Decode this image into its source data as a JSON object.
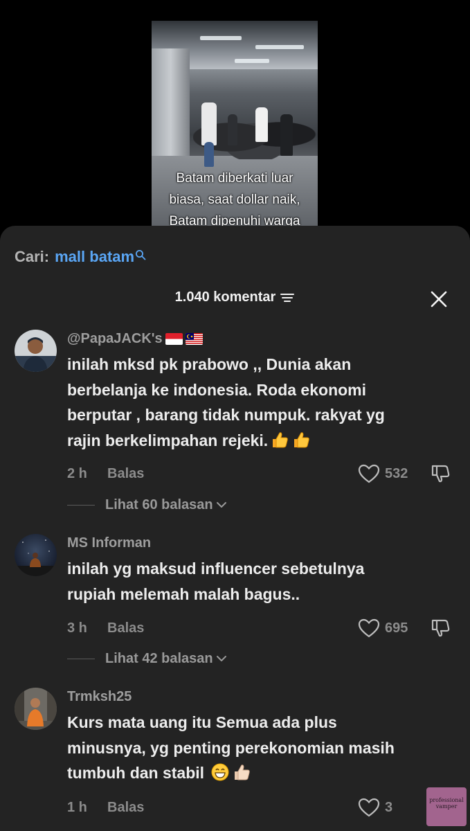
{
  "video": {
    "caption": "Batam diberkati luar\nbiasa, saat dollar naik,\nBatam dipenuhi warga"
  },
  "search": {
    "prefix": "Cari:",
    "term": "mall batam",
    "icon": "search-icon"
  },
  "header": {
    "comment_count": "1.040 komentar",
    "filter_icon": "filter-icon",
    "close_icon": "close-icon"
  },
  "comments": [
    {
      "username": "@PapaJACK's",
      "flags": [
        "Indonesia",
        "Malaysia"
      ],
      "text": "inilah mksd pk prabowo ,, Dunia akan\nberbelanja ke indonesia. Roda ekonomi\nberputar , barang tidak numpuk. rakyat yg\nrajin berkelimpahan rejeki.",
      "emoji": [
        "thumbs-up",
        "thumbs-up"
      ],
      "time": "2 h",
      "reply_label": "Balas",
      "likes": "532",
      "view_replies": "Lihat 60 balasan"
    },
    {
      "username": "MS Informan",
      "text": "inilah yg maksud influencer sebetulnya\nrupiah melemah malah bagus..",
      "time": "3 h",
      "reply_label": "Balas",
      "likes": "695",
      "view_replies": "Lihat 42 balasan"
    },
    {
      "username": "Trmksh25",
      "text": "Kurs mata uang itu Semua ada plus\nminusnya, yg penting perekonomian masih\ntumbuh dan stabil",
      "emoji": [
        "grinning-face",
        "thumbs-up-light"
      ],
      "time": "1 h",
      "reply_label": "Balas",
      "likes": "3"
    }
  ],
  "watermark": {
    "text": "professional\nvamper"
  },
  "colors": {
    "sheet_bg": "#232323",
    "search_term": "#5aa6f5",
    "muted": "#8c8c8c"
  }
}
